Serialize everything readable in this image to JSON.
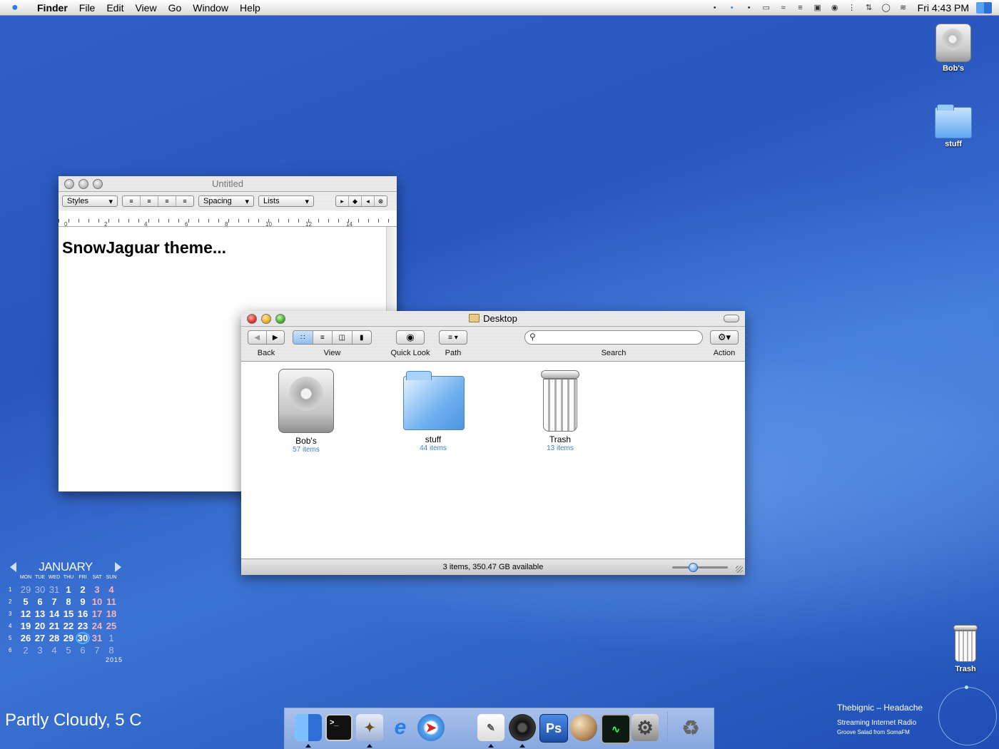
{
  "menubar": {
    "apple": "",
    "items": [
      "Finder",
      "File",
      "Edit",
      "View",
      "Go",
      "Window",
      "Help"
    ],
    "clock": "Fri 4:43 PM"
  },
  "desktop_icons": {
    "hd": "Bob's ",
    "folder": "stuff",
    "trash": "Trash"
  },
  "textedit": {
    "title": "Untitled",
    "styles": "Styles",
    "spacing": "Spacing",
    "lists": "Lists",
    "ruler": [
      "0",
      "2",
      "4",
      "6",
      "8",
      "10",
      "12",
      "14"
    ],
    "content": "SnowJaguar theme..."
  },
  "finder": {
    "title": "Desktop",
    "toolbar": {
      "back": "Back",
      "view": "View",
      "quicklook": "Quick Look",
      "path": "Path",
      "search": "Search",
      "action": "Action",
      "search_placeholder": ""
    },
    "items": [
      {
        "name": "Bob's ",
        "count": "57 items"
      },
      {
        "name": "stuff",
        "count": "44 items"
      },
      {
        "name": "Trash",
        "count": "13 items"
      }
    ],
    "status": "3 items, 350.47 GB available",
    "icon_size_level": 0.35
  },
  "calendar": {
    "month": "JANUARY",
    "year": "2015",
    "dow": [
      "MON",
      "TUE",
      "WED",
      "THU",
      "FRI",
      "SAT",
      "SUN"
    ],
    "weeks": [
      {
        "wk": "1",
        "days": [
          "29",
          "30",
          "31",
          "1",
          "2",
          "3",
          "4"
        ]
      },
      {
        "wk": "2",
        "days": [
          "5",
          "6",
          "7",
          "8",
          "9",
          "10",
          "11"
        ]
      },
      {
        "wk": "3",
        "days": [
          "12",
          "13",
          "14",
          "15",
          "16",
          "17",
          "18"
        ]
      },
      {
        "wk": "4",
        "days": [
          "19",
          "20",
          "21",
          "22",
          "23",
          "24",
          "25"
        ]
      },
      {
        "wk": "5",
        "days": [
          "26",
          "27",
          "28",
          "29",
          "30",
          "31",
          "1"
        ]
      },
      {
        "wk": "6",
        "days": [
          "2",
          "3",
          "4",
          "5",
          "6",
          "7",
          "8"
        ]
      }
    ],
    "today": "30"
  },
  "weather": "Partly Cloudy, 5 C",
  "music": {
    "song": "Thebignic – Headache",
    "station": "Streaming Internet Radio",
    "sub": "Groove Salad from SomaFM"
  },
  "dock": {
    "items": [
      "finder-icon",
      "terminal-icon",
      "mail-icon",
      "internet-explorer-icon",
      "safari-icon",
      "textedit-icon",
      "itunes-icon",
      "photoshop-icon",
      "planet-icon",
      "activity-monitor-icon",
      "system-preferences-icon",
      "trash-icon"
    ],
    "ps_label": "Ps"
  }
}
